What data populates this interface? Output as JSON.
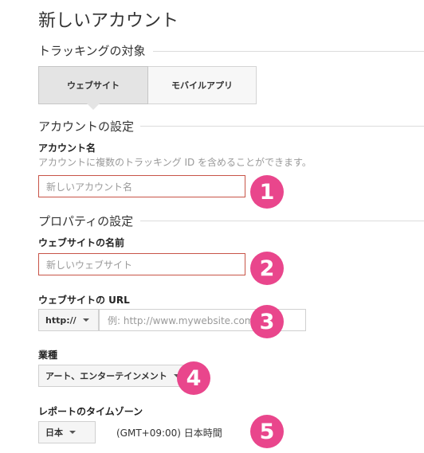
{
  "page_title": "新しいアカウント",
  "tracking": {
    "section_title": "トラッキングの対象",
    "tabs": [
      {
        "label": "ウェブサイト",
        "active": true
      },
      {
        "label": "モバイルアプリ",
        "active": false
      }
    ]
  },
  "account_settings": {
    "section_title": "アカウントの設定",
    "account_name_label": "アカウント名",
    "account_name_help": "アカウントに複数のトラッキング ID を含めることができます。",
    "account_name_placeholder": "新しいアカウント名"
  },
  "property_settings": {
    "section_title": "プロパティの設定",
    "website_name_label": "ウェブサイトの名前",
    "website_name_placeholder": "新しいウェブサイト",
    "url_label": "ウェブサイトの URL",
    "protocol_value": "http://",
    "url_placeholder": "例: http://www.mywebsite.com",
    "industry_label": "業種",
    "industry_value": "アート、エンターテインメント",
    "timezone_label": "レポートのタイムゾーン",
    "country_value": "日本",
    "timezone_value": "(GMT+09:00) 日本時間"
  },
  "badges": [
    "1",
    "2",
    "3",
    "4",
    "5"
  ],
  "colors": {
    "badge": "#e9468c",
    "error_border": "#c85448"
  }
}
